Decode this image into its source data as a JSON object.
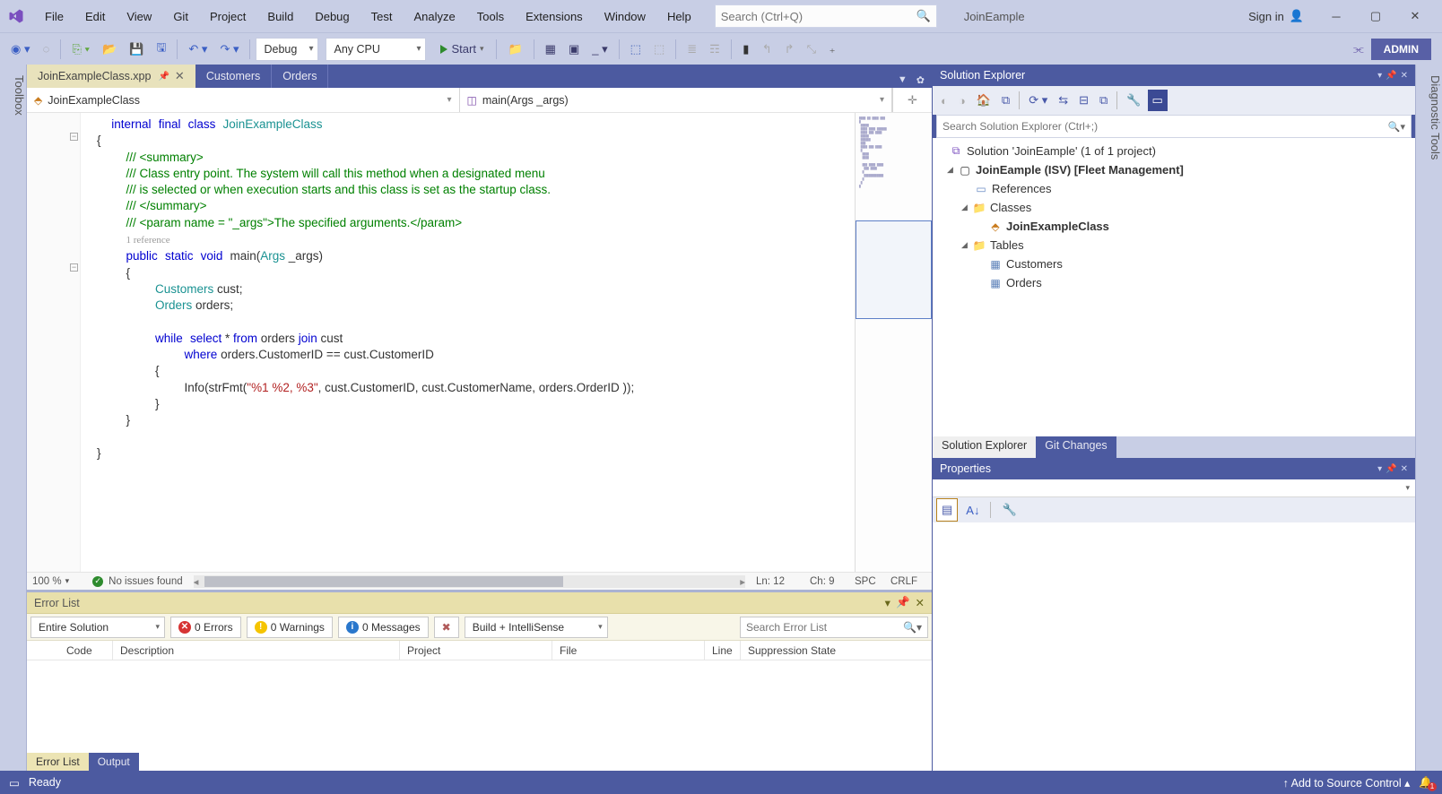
{
  "menu": [
    "File",
    "Edit",
    "View",
    "Git",
    "Project",
    "Build",
    "Debug",
    "Test",
    "Analyze",
    "Tools",
    "Extensions",
    "Window",
    "Help"
  ],
  "title_search_placeholder": "Search (Ctrl+Q)",
  "solution_title": "JoinEample",
  "signin_label": "Sign in",
  "toolbar": {
    "config": "Debug",
    "platform": "Any CPU",
    "start": "Start",
    "admin": "ADMIN"
  },
  "left_tool": "Toolbox",
  "right_tool": "Diagnostic Tools",
  "tabs": [
    {
      "label": "JoinExampleClass.xpp",
      "active": true
    },
    {
      "label": "Customers",
      "active": false
    },
    {
      "label": "Orders",
      "active": false
    }
  ],
  "nav_left": "JoinExampleClass",
  "nav_right": "main(Args _args)",
  "code": {
    "l1a": "internal",
    "l1b": "final",
    "l1c": "class",
    "l1d": "JoinExampleClass",
    "l2": "{",
    "l3": "/// <summary>",
    "l4": "/// Class entry point. The system will call this method when a designated menu",
    "l5": "/// is selected or when execution starts and this class is set as the startup class.",
    "l6": "/// </summary>",
    "l7": "/// <param name = \"_args\">The specified arguments.</param>",
    "l8": "1 reference",
    "l9a": "public",
    "l9b": "static",
    "l9c": "void",
    "l9d": "main(",
    "l9e": "Args",
    "l9f": " _args)",
    "l10": "{",
    "l11a": "Customers",
    "l11b": " cust;",
    "l12a": "Orders",
    "l12b": " orders;",
    "l14a": "while",
    "l14b": "select",
    "l14c": " * ",
    "l14d": "from",
    "l14e": " orders ",
    "l14f": "join",
    "l14g": " cust",
    "l15a": "where",
    "l15b": " orders.CustomerID == cust.CustomerID",
    "l16": "{",
    "l17a": "Info(strFmt(",
    "l17b": "\"%1 %2, %3\"",
    "l17c": ", cust.CustomerID, cust.CustomerName, orders.OrderID ));",
    "l18": "}",
    "l19": "}",
    "l21": "}"
  },
  "editor_status": {
    "zoom": "100 %",
    "issues": "No issues found",
    "ln": "Ln: 12",
    "ch": "Ch: 9",
    "ins": "SPC",
    "eol": "CRLF"
  },
  "error_list": {
    "title": "Error List",
    "scope": "Entire Solution",
    "errors": "0 Errors",
    "warnings": "0 Warnings",
    "messages": "0 Messages",
    "build": "Build + IntelliSense",
    "search_placeholder": "Search Error List",
    "cols": [
      "Code",
      "Description",
      "Project",
      "File",
      "Line",
      "Suppression State"
    ],
    "tabs": [
      "Error List",
      "Output"
    ]
  },
  "solution_explorer": {
    "title": "Solution Explorer",
    "search_placeholder": "Search Solution Explorer (Ctrl+;)",
    "root": "Solution 'JoinEample' (1 of 1 project)",
    "project": "JoinEample (ISV) [Fleet Management]",
    "references": "References",
    "classes": "Classes",
    "class1": "JoinExampleClass",
    "tables": "Tables",
    "table1": "Customers",
    "table2": "Orders",
    "bottom_tabs": [
      "Solution Explorer",
      "Git Changes"
    ]
  },
  "properties": {
    "title": "Properties"
  },
  "status": {
    "ready": "Ready",
    "source": "Add to Source Control",
    "bell": "1"
  }
}
